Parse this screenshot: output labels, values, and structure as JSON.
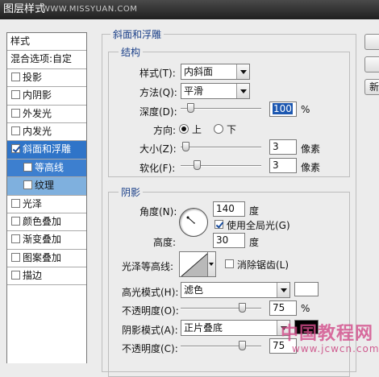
{
  "window": {
    "title": "图层样式",
    "watermark_top": "WWW.MISSYUAN.COM"
  },
  "style_list": {
    "header": "样式",
    "blend": "混合选项:自定",
    "items": [
      {
        "label": "投影",
        "checked": false
      },
      {
        "label": "内阴影",
        "checked": false
      },
      {
        "label": "外发光",
        "checked": false
      },
      {
        "label": "内发光",
        "checked": false
      },
      {
        "label": "斜面和浮雕",
        "checked": true
      },
      {
        "label": "等高线",
        "checked": false
      },
      {
        "label": "纹理",
        "checked": false
      },
      {
        "label": "光泽",
        "checked": false
      },
      {
        "label": "颜色叠加",
        "checked": false
      },
      {
        "label": "渐变叠加",
        "checked": false
      },
      {
        "label": "图案叠加",
        "checked": false
      },
      {
        "label": "描边",
        "checked": false
      }
    ]
  },
  "bevel": {
    "title": "斜面和浮雕",
    "structure": {
      "title": "结构",
      "style_label": "样式(T):",
      "style_value": "内斜面",
      "method_label": "方法(Q):",
      "method_value": "平滑",
      "depth_label": "深度(D):",
      "depth_value": "100",
      "depth_unit": "%",
      "direction_label": "方向:",
      "dir_up": "上",
      "dir_down": "下",
      "size_label": "大小(Z):",
      "size_value": "3",
      "size_unit": "像素",
      "soften_label": "软化(F):",
      "soften_value": "3",
      "soften_unit": "像素"
    },
    "shading": {
      "title": "阴影",
      "angle_label": "角度(N):",
      "angle_value": "140",
      "angle_unit": "度",
      "global_light_label": "使用全局光(G)",
      "altitude_label": "高度:",
      "altitude_value": "30",
      "altitude_unit": "度",
      "gloss_label": "光泽等高线:",
      "antialias_label": "消除锯齿(L)",
      "highlight_mode_label": "高光模式(H):",
      "highlight_mode_value": "滤色",
      "highlight_opacity_label": "不透明度(O):",
      "highlight_opacity_value": "75",
      "highlight_opacity_unit": "%",
      "shadow_mode_label": "阴影模式(A):",
      "shadow_mode_value": "正片叠底",
      "shadow_opacity_label": "不透明度(C):",
      "shadow_opacity_value": "75"
    }
  },
  "side_buttons": {
    "third_partial": "新"
  },
  "bottom_watermark": {
    "brand": "中国教程网",
    "url": "www.jcwcn.com"
  },
  "colors": {
    "highlight_swatch": "#ffffff",
    "shadow_swatch": "#000000",
    "selected_item": "#2f74c8"
  }
}
